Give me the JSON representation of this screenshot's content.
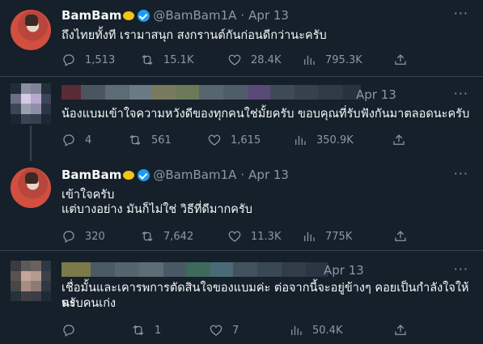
{
  "tweets": [
    {
      "name": "BamBam",
      "handle": "@BamBam1A",
      "date": "Apr 13",
      "text": "ถึงไทยทั้งที เรามาสนุก สงกรานต์กันก่อนดีกว่านะครับ",
      "stats": {
        "replies": "1,513",
        "retweets": "15.1K",
        "likes": "28.4K",
        "views": "795.3K"
      }
    },
    {
      "date": "Apr 13",
      "text": "น้องแบมเข้าใจความหวังดีของทุกคนใช่มั้ยครับ ขอบคุณที่รับฟังกันมาตลอดนะครับ",
      "stats": {
        "replies": "4",
        "retweets": "561",
        "likes": "1,615",
        "views": "350.9K"
      }
    },
    {
      "name": "BamBam",
      "handle": "@BamBam1A",
      "date": "Apr 13",
      "text_line1": "เข้าใจครับ",
      "text_line2": "แต่บางอย่าง มันก็ไม่ใช่ วิธีที่ดีมากครับ",
      "stats": {
        "replies": "320",
        "retweets": "7,642",
        "likes": "11.3K",
        "views": "775K"
      }
    },
    {
      "date": "Apr 13",
      "text_line1": "เชื่อมั้นและเคารพการตัดสินใจของแบมค่ะ ต่อจากนี้จะอยู่ข้างๆ คอยเป็นกำลังใจให้นะ",
      "text_line2": "ครับคนเก่ง",
      "stats": {
        "replies": "",
        "retweets": "1",
        "likes": "7",
        "views": "50.4K"
      }
    }
  ],
  "more_label": "···",
  "colors": {
    "background": "#15202b",
    "verified": "#1d9bf0",
    "muted": "#8b98a5"
  }
}
